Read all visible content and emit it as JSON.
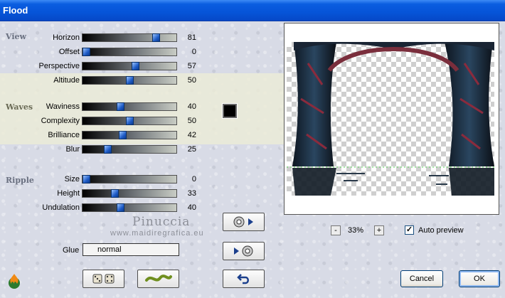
{
  "window": {
    "title": "Flood"
  },
  "groups": {
    "view": {
      "label": "View",
      "params": [
        {
          "label": "Horizon",
          "value": "81",
          "level": 0.81
        },
        {
          "label": "Offset",
          "value": "0",
          "level": 0.0
        },
        {
          "label": "Perspective",
          "value": "57",
          "level": 0.57
        },
        {
          "label": "Altitude",
          "value": "50",
          "level": 0.5
        }
      ]
    },
    "waves": {
      "label": "Waves",
      "params": [
        {
          "label": "Waviness",
          "value": "40",
          "level": 0.4
        },
        {
          "label": "Complexity",
          "value": "50",
          "level": 0.5
        },
        {
          "label": "Brilliance",
          "value": "42",
          "level": 0.42
        },
        {
          "label": "Blur",
          "value": "25",
          "level": 0.25
        }
      ],
      "color": "#000000"
    },
    "ripple": {
      "label": "Ripple",
      "params": [
        {
          "label": "Size",
          "value": "0",
          "level": 0.0
        },
        {
          "label": "Height",
          "value": "33",
          "level": 0.33
        },
        {
          "label": "Undulation",
          "value": "40",
          "level": 0.4
        }
      ]
    }
  },
  "glue": {
    "label": "Glue",
    "value": "normal"
  },
  "preview": {
    "zoom_minus": "-",
    "zoom_value": "33%",
    "zoom_plus": "+",
    "auto_preview_label": "Auto preview",
    "auto_preview_checked": true
  },
  "watermark": {
    "line1": "Pinuccia",
    "line2": "www.maidiregrafica.eu"
  },
  "buttons": {
    "cancel": "Cancel",
    "ok": "OK"
  },
  "icons": {
    "randomize": "dice-icon",
    "wave": "wave-icon",
    "save_preset": "disc-arrow-right-icon",
    "load_preset": "arrow-disc-icon",
    "reset": "undo-arrow-icon",
    "logo": "flame-logo-icon"
  },
  "colors": {
    "title_bar": "#0654d8",
    "slider_thumb": "#1e5bc6",
    "waves_band": "#ebebd7"
  }
}
